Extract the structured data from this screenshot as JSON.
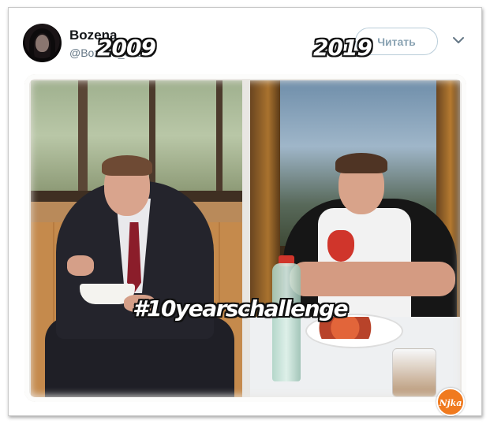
{
  "tweet": {
    "author_name": "Bozena",
    "author_handle": "@Bozena_Grant",
    "follow_label": "Читать",
    "menu_icon": "chevron-down-icon"
  },
  "media": {
    "left_year": "2009",
    "right_year": "2019",
    "hashtag": "#10yearschallenge",
    "watermark": "Njka"
  }
}
